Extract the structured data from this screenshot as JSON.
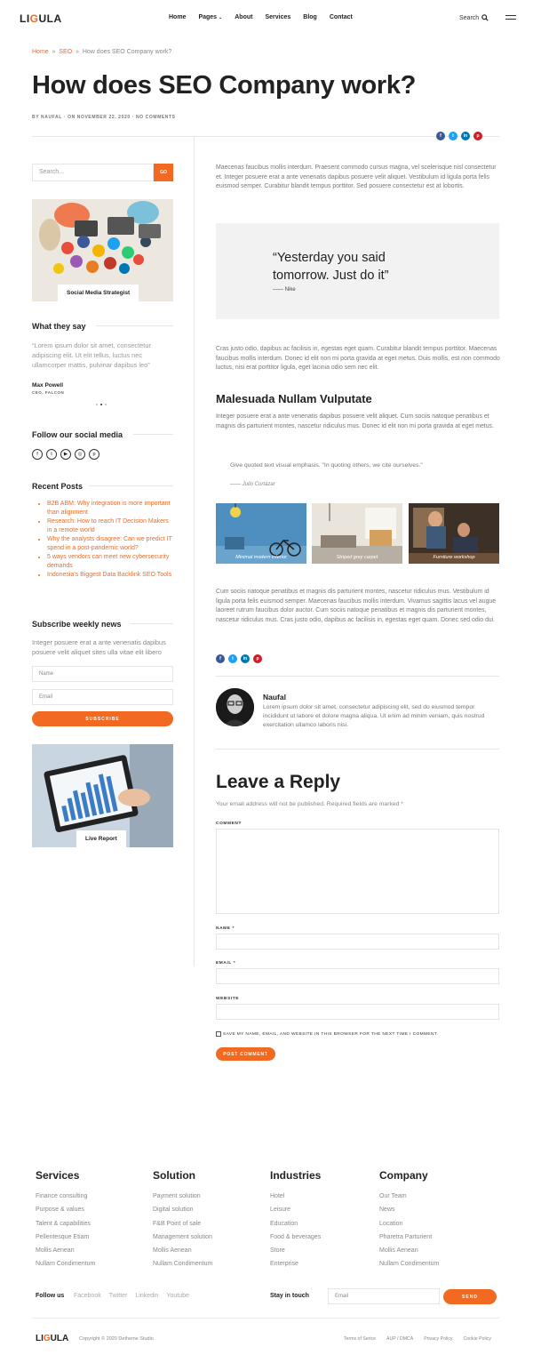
{
  "header": {
    "logo_pre": "LI",
    "logo_acc": "G",
    "logo_post": "ULA",
    "nav": [
      "Home",
      "Pages",
      "About",
      "Services",
      "Blog",
      "Contact"
    ],
    "search_label": "Search"
  },
  "breadcrumb": {
    "home": "Home",
    "sep": "»",
    "cat": "SEO",
    "current": "How does SEO Company work?"
  },
  "post": {
    "title": "How does SEO Company work?",
    "meta": "BY NAUFAL · ON NOVEMBER 22, 2020 · NO COMMENTS"
  },
  "share_icons": [
    "facebook-icon",
    "twitter-icon",
    "linkedin-icon",
    "pinterest-icon"
  ],
  "colors": {
    "accent": "#f26a22",
    "facebook": "#3b5998",
    "twitter": "#1da1f2",
    "linkedin": "#0077b5",
    "pinterest": "#cb2027"
  },
  "sidebar": {
    "search_placeholder": "Search...",
    "search_button": "GO",
    "image1_caption": "Social Media Strategist",
    "testimonials_heading": "What they say",
    "testimonial_text": "“Lorem ipsum dolor sit amet, consectetur adipiscing elit. Ut elit tellus, luctus nec ullamcorper mattis, pulvinar dapibus leo”",
    "testimonial_name": "Max Powell",
    "testimonial_role": "CEO, FALCON",
    "social_heading": "Follow our social media",
    "social_icons": [
      "facebook-icon",
      "twitter-icon",
      "youtube-icon",
      "instagram-icon",
      "pinterest-icon"
    ],
    "recent_heading": "Recent Posts",
    "recent_posts": [
      "B2B ABM: Why integration is more important than alignment",
      "Research: How to reach IT Decision Makers in a remote world",
      "Why the analysts disagree: Can we predict IT spend in a post-pandemic world?",
      "5 ways vendors can meet new cybersecurity demands",
      "Indonesia's Biggest Data Backlink SEO Tools"
    ],
    "subscribe_heading": "Subscribe weekly news",
    "subscribe_text": "Integer posuere erat a ante venenatis dapibus posuere velit aliquet sites ulla vitae elit libero",
    "name_placeholder": "Name",
    "email_placeholder": "Email",
    "subscribe_button": "SUBSCRIBE",
    "image2_caption": "Live Report"
  },
  "content": {
    "p1": "Maecenas faucibus mollis interdum. Praesent commodo cursus magna, vel scelerisque nisl consectetur et. Integer posuere erat a ante venenatis dapibus posuere velit aliquet. Vestibulum id ligula porta felis euismod semper. Curabitur blandit tempus porttitor. Sed posuere consectetur est at lobortis.",
    "blockquote": "“Yesterday you said tomorrow. Just do it”",
    "blockquote_author": "—— Nike",
    "p2": "Cras justo odio, dapibus ac facilisis in, egestas eget quam. Curabitur blandit tempus porttitor. Maecenas faucibus mollis interdum. Donec id elit non mi porta gravida at eget metus. Duis mollis, est non commodo luctus, nisi erat porttitor ligula, eget lacinia odio sem nec elit.",
    "h2": "Malesuada Nullam Vulputate",
    "p3": "Integer posuere erat a ante venenatis dapibus posuere velit aliquet. Cum sociis natoque penatibus et magnis dis parturient montes, nascetur ridiculus mus. Donec id elit non mi porta gravida at eget metus.",
    "inline_quote": "Give quoted text visual emphasis. \"In quoting others, we cite ourselves.\"",
    "inline_quote_author": "—— Julio Cortázar",
    "gallery": [
      "Minimal modern interior",
      "Striped grey carpet",
      "Furniture workshop"
    ],
    "p4": "Cum sociis natoque penatibus et magnis dis parturient montes, nascetur ridiculus mus. Vestibulum id ligula porta felis euismod semper. Maecenas faucibus mollis interdum. Vivamus sagittis lacus vel augue laoreet rutrum faucibus dolor auctor. Cum sociis natoque penatibus et magnis dis parturient montes, nascetur ridiculus mus. Cras justo odio, dapibus ac facilisis in, egestas eget quam. Donec sed odio dui.",
    "author_name": "Naufal",
    "author_bio": "Lorem ipsum dolor sit amet, consectetur adipiscing elit, sed do eiusmod tempor incididunt ut labore et dolore magna aliqua. Ut enim ad minim veniam, quis nostrud exercitation ullamco laboris nisi."
  },
  "reply": {
    "heading": "Leave a Reply",
    "note": "Your email address will not be published. Required fields are marked *",
    "comment_label": "COMMENT",
    "name_label": "NAME *",
    "email_label": "EMAIL *",
    "website_label": "WEBSITE",
    "checkbox_label": "SAVE MY NAME, EMAIL, AND WEBSITE IN THIS BROWSER FOR THE NEXT TIME I COMMENT.",
    "button": "POST COMMENT"
  },
  "footer": {
    "columns": [
      {
        "title": "Services",
        "items": [
          "Finance consulting",
          "Purpose & values",
          "Talent & capabilities",
          "Pellentesque Etiam",
          "Mollis Aenean",
          "Nullam Condimentum"
        ]
      },
      {
        "title": "Solution",
        "items": [
          "Payment solution",
          "Digital solution",
          "F&B Point of sale",
          "Management solution",
          "Mollis Aenean",
          "Nullam Condimentum"
        ]
      },
      {
        "title": "Industries",
        "items": [
          "Hotel",
          "Leisure",
          "Education",
          "Food & beverages",
          "Store",
          "Enterprise"
        ]
      },
      {
        "title": "Company",
        "items": [
          "Our Team",
          "News",
          "Location",
          "Pharetra Parturient",
          "Mollis Aenean",
          "Nullam Condimentum"
        ]
      }
    ],
    "follow_label": "Follow us",
    "follow_links": [
      "Facebook",
      "Twitter",
      "Linkedin",
      "Youtube"
    ],
    "stay_label": "Stay in touch",
    "email_placeholder": "Email",
    "send_button": "SEND",
    "logo": "LIGULA",
    "copyright": "Copyright © 2020 Detheme Studio",
    "links": [
      "Terms of Serice",
      "AUP / DMCA",
      "Privacy Policy",
      "Cookie Policy"
    ]
  }
}
